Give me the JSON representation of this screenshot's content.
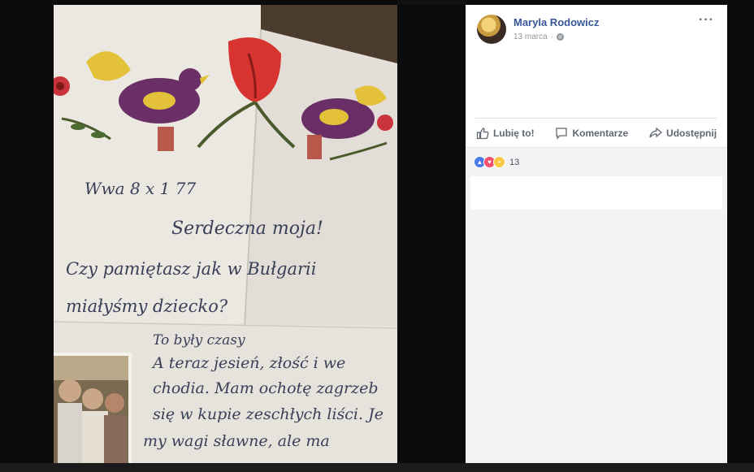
{
  "post": {
    "author": "Maryla Rodowicz",
    "date": "13 marca",
    "date_separator": "·",
    "more_label": "···"
  },
  "actions": {
    "like": "Lubię to!",
    "comment": "Komentarze",
    "share": "Udostępnij"
  },
  "reactions": {
    "count": "13",
    "types": [
      "like-icon",
      "love-icon",
      "wow-icon"
    ]
  },
  "photo": {
    "letter_lines": [
      "Wwa 8 x 1 77",
      "Serdeczna moja!",
      "Czy pamiętasz jak w Bułgarii",
      "miałyśmy dziecko?",
      "To były czasy",
      "A teraz jesień, złość i we",
      "chodia. Mam ochotę zagrzeb",
      "się w kupie zeschłych liści. Je",
      "my wagi sławne, ale ma"
    ]
  },
  "colors": {
    "link": "#365899",
    "paper": "#e9e6e0",
    "ink": "#3a3f58"
  }
}
